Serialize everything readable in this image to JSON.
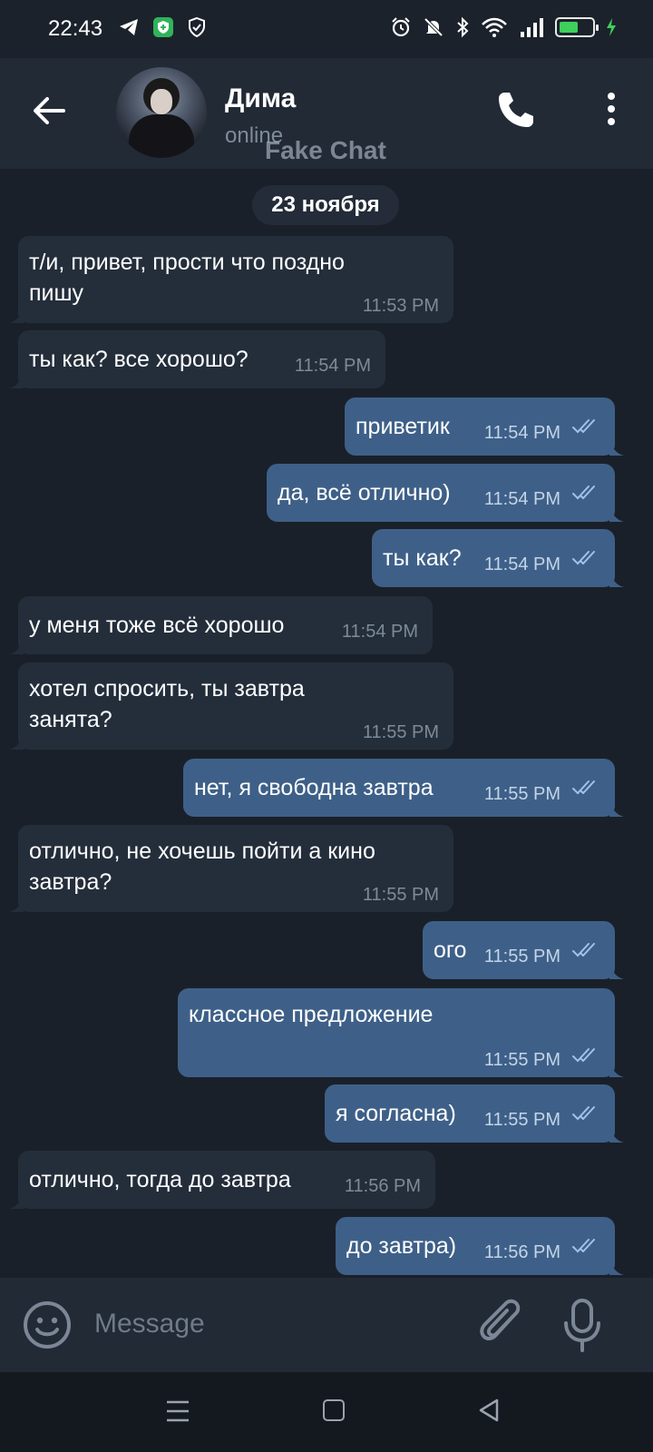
{
  "status_bar": {
    "time": "22:43",
    "icons_left": [
      "telegram-icon",
      "shield-app-icon",
      "shield-check-icon"
    ],
    "icons_right": [
      "alarm-icon",
      "mute-icon",
      "bluetooth-icon",
      "wifi-icon",
      "signal-icon",
      "battery-icon",
      "charging-icon"
    ]
  },
  "header": {
    "contact_name": "Дима",
    "status": "online",
    "watermark": "Fake Chat"
  },
  "chat": {
    "date_label": "23 ноября",
    "messages": [
      {
        "dir": "in",
        "line1": "т/и, привет, прости что поздно",
        "line2": "пишу",
        "time": "11:53 PM"
      },
      {
        "dir": "in",
        "line1": "ты как? все хорошо?",
        "time": "11:54 PM"
      },
      {
        "dir": "out",
        "line1": "приветик",
        "time": "11:54 PM"
      },
      {
        "dir": "out",
        "line1": "да, всё отлично)",
        "time": "11:54 PM"
      },
      {
        "dir": "out",
        "line1": "ты как?",
        "time": "11:54 PM"
      },
      {
        "dir": "in",
        "line1": "у меня тоже всё хорошо",
        "time": "11:54 PM"
      },
      {
        "dir": "in",
        "line1": "хотел спросить, ты завтра",
        "line2": "занята?",
        "time": "11:55 PM"
      },
      {
        "dir": "out",
        "line1": "нет, я свободна завтра",
        "time": "11:55 PM"
      },
      {
        "dir": "in",
        "line1": "отлично, не хочешь пойти а кино",
        "line2": "завтра?",
        "time": "11:55 PM"
      },
      {
        "dir": "out",
        "line1": "ого",
        "time": "11:55 PM"
      },
      {
        "dir": "out",
        "line1": "классное предложение",
        "time": "11:55 PM"
      },
      {
        "dir": "out",
        "line1": "я согласна)",
        "time": "11:55 PM"
      },
      {
        "dir": "in",
        "line1": "отлично, тогда до завтра",
        "time": "11:56 PM"
      },
      {
        "dir": "out",
        "line1": "до завтра)",
        "time": "11:56 PM"
      }
    ]
  },
  "composer": {
    "placeholder": "Message"
  },
  "colors": {
    "background": "#1a2029",
    "incoming_bubble": "#242e3b",
    "outgoing_bubble": "#3e6088",
    "header": "#212a35"
  }
}
